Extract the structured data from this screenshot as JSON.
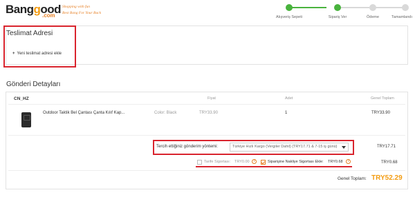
{
  "logo": {
    "word_start": "Bang",
    "word_o": "g",
    "word_end": "ood",
    "com": ".com",
    "tagline_1": "Shopping with fun",
    "tagline_2": "Best Bang For Your Buck"
  },
  "progress": {
    "steps": [
      {
        "label": "Alışveriş Sepeti",
        "done": true
      },
      {
        "label": "Sipariş Ver",
        "done": true
      },
      {
        "label": "Ödeme",
        "done": false
      },
      {
        "label": "Tamamlandı",
        "done": false
      }
    ],
    "colors": {
      "done": "#49b33d",
      "todo": "#d9d9d9"
    }
  },
  "address": {
    "title": "Teslimat Adresi",
    "add_label": "Yeni teslimat adresi ekle",
    "add_icon": "plus-icon"
  },
  "shipment": {
    "title": "Gönderi Detayları",
    "warehouse": "CN_HZ",
    "columns": {
      "price": "Fiyat",
      "qty": "Adet",
      "total": "Genel Toplam"
    },
    "item": {
      "name": "Outdoor Taktik Bel Çantası Çanta Kılıf Kap...",
      "color": "Color: Black",
      "price": "TRY33.90",
      "qty": "1",
      "total": "TRY33.90"
    },
    "method": {
      "label": "Tercih ettiğiniz gönderim yöntemi:",
      "selected": "Türkiye Hızlı Kargo (Vergiler Dahil) (TRY17.71 & 7-15 iş günü)",
      "cost": "TRY17.71"
    },
    "insurance": {
      "tariff_label": "Tarife Sigortası:",
      "tariff_value": "TRY0.00",
      "shipping_label": "Siparişine Nakliye Sigortası Ekle:",
      "shipping_value": "TRY0.68",
      "cost": "TRY0.68"
    },
    "grand_total_label": "Genel Toplam:",
    "grand_total": "TRY52.29"
  },
  "colors": {
    "highlight": "#d9232d",
    "accent": "#f39c12"
  }
}
